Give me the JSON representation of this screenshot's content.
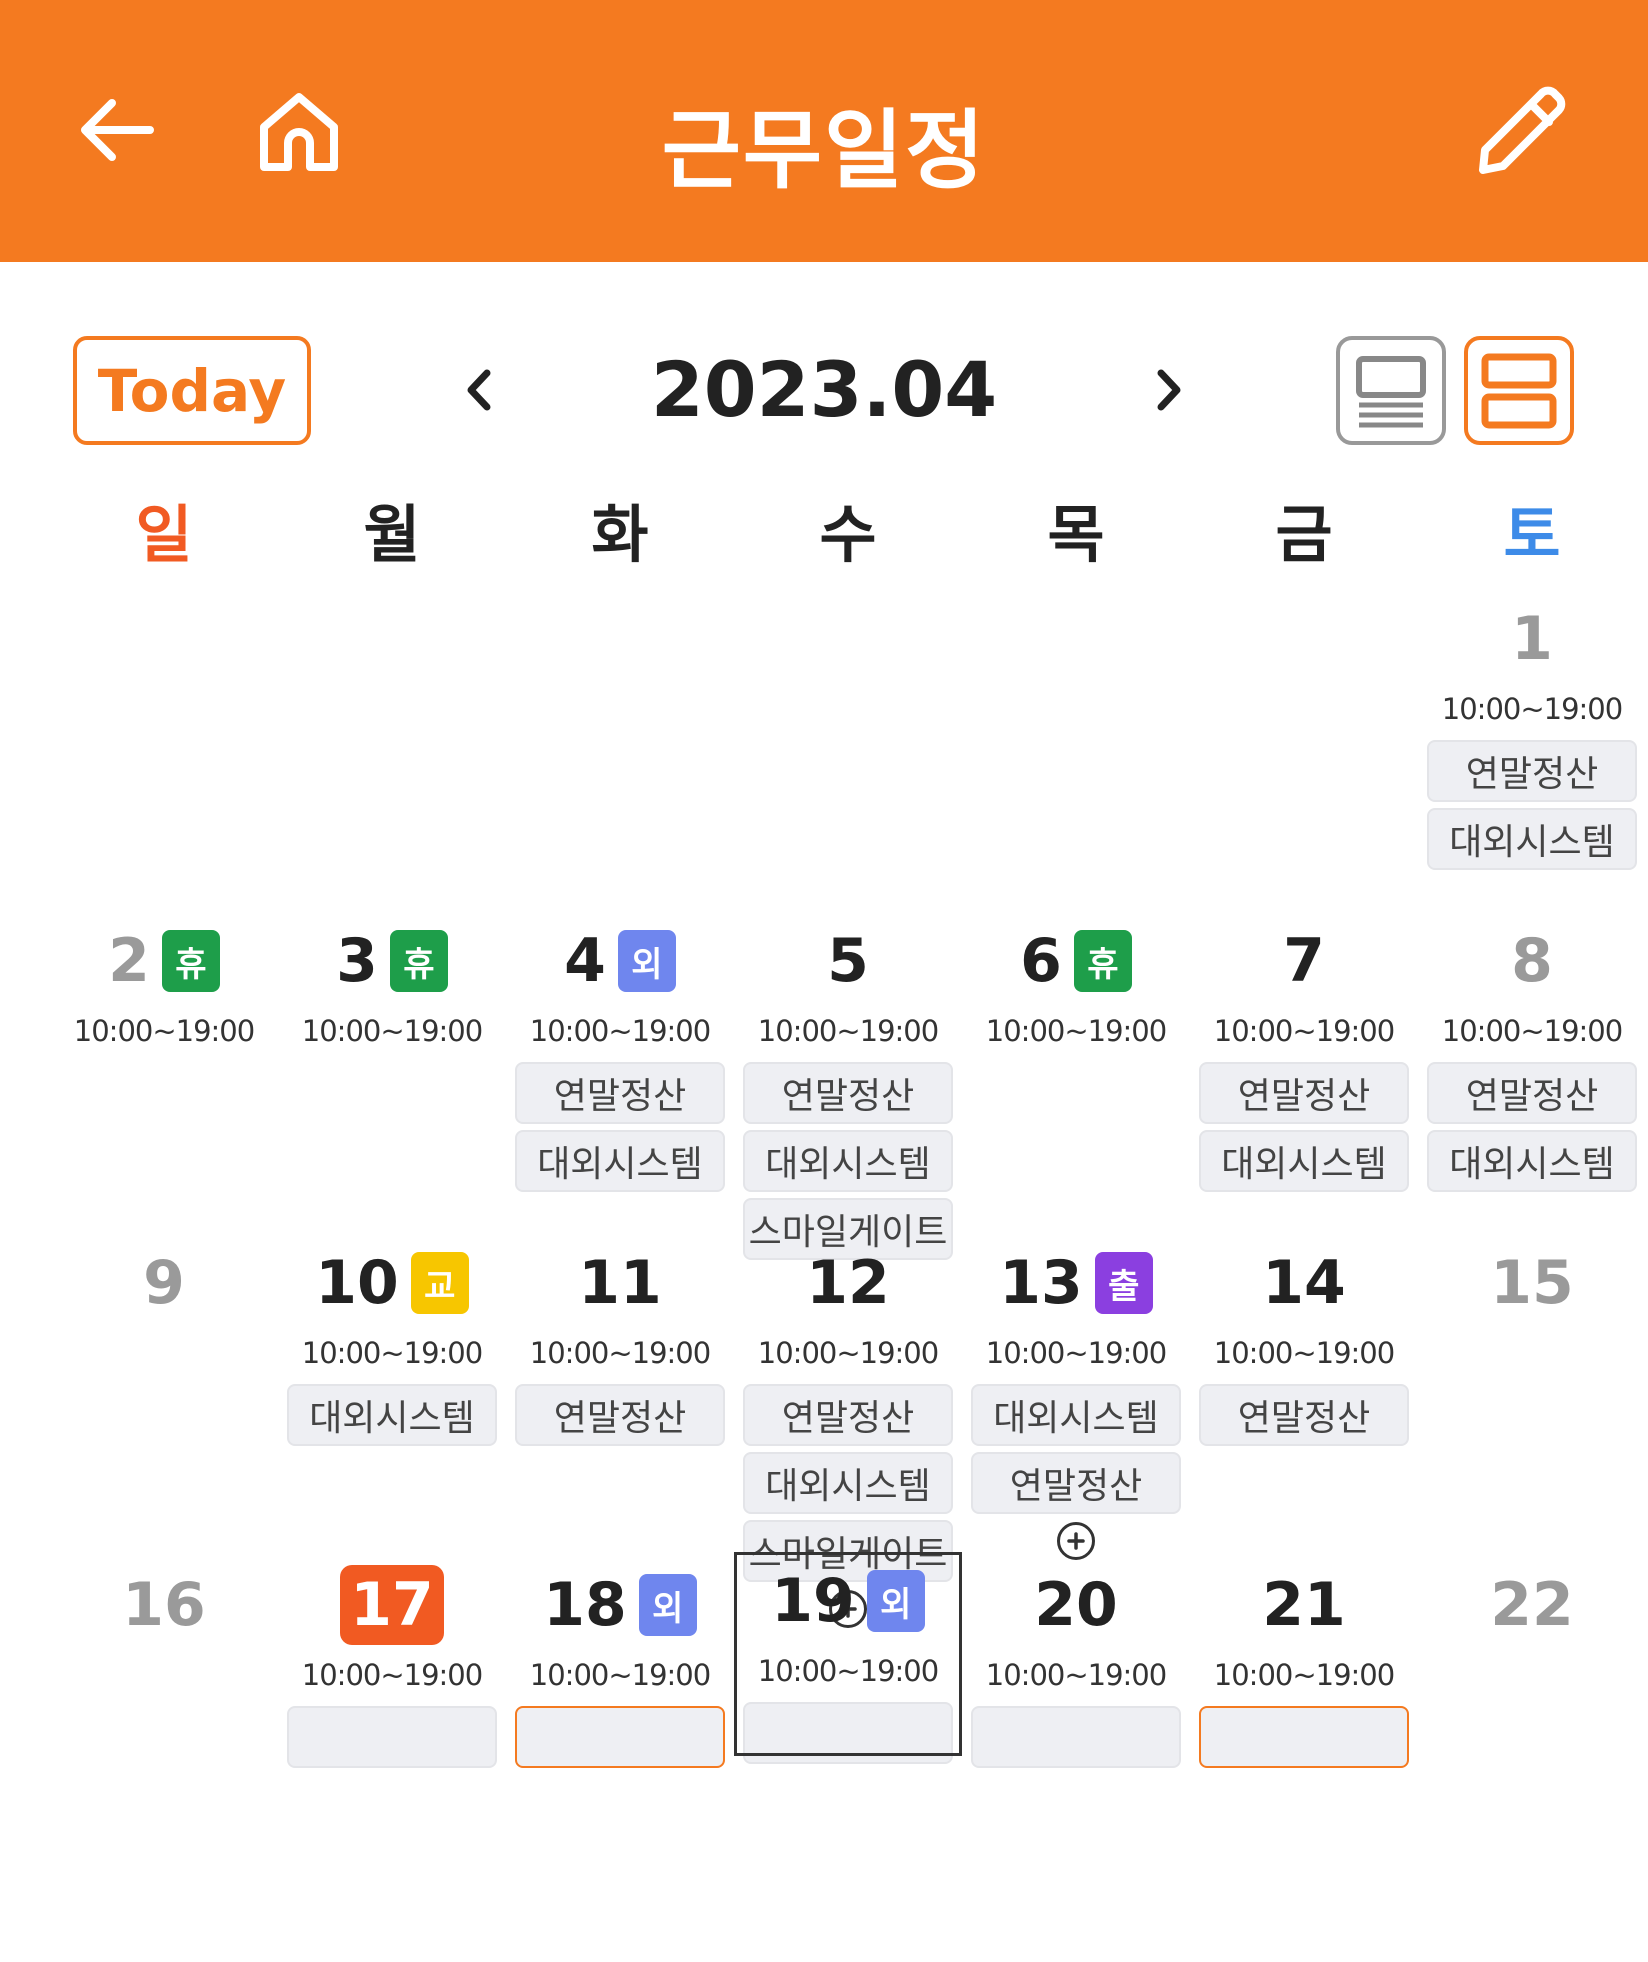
{
  "header": {
    "title": "근무일정",
    "back_icon": "arrow-left-icon",
    "home_icon": "home-icon",
    "edit_icon": "pencil-icon"
  },
  "toolbar": {
    "today_label": "Today",
    "month": "2023.04",
    "prev_icon": "chevron-left-icon",
    "next_icon": "chevron-right-icon",
    "view_list_icon": "list-view-icon",
    "view_split_icon": "split-view-icon"
  },
  "weekdays": [
    "일",
    "월",
    "화",
    "수",
    "목",
    "금",
    "토"
  ],
  "colors": {
    "accent": "#F47A20",
    "today": "#F15A22",
    "sunday": "#F15A22",
    "saturday": "#3D8BE8",
    "badge_rest": "#1E9E4A",
    "badge_out": "#6F86EE",
    "badge_edu": "#F7C600",
    "badge_trip": "#8B3FE0"
  },
  "weeks": [
    [
      null,
      null,
      null,
      null,
      null,
      null,
      {
        "day": "1",
        "weekend": true,
        "time": "10:00~19:00",
        "tags": [
          "연말정산",
          "대외시스템"
        ]
      }
    ],
    [
      {
        "day": "2",
        "weekend": true,
        "badge": "휴",
        "badge_color": "#1E9E4A",
        "time": "10:00~19:00",
        "tags": []
      },
      {
        "day": "3",
        "badge": "휴",
        "badge_color": "#1E9E4A",
        "time": "10:00~19:00",
        "tags": []
      },
      {
        "day": "4",
        "badge": "외",
        "badge_color": "#6F86EE",
        "time": "10:00~19:00",
        "tags": [
          "연말정산",
          "대외시스템"
        ]
      },
      {
        "day": "5",
        "time": "10:00~19:00",
        "tags": [
          "연말정산",
          "대외시스템",
          "스마일게이트"
        ]
      },
      {
        "day": "6",
        "badge": "휴",
        "badge_color": "#1E9E4A",
        "time": "10:00~19:00",
        "tags": []
      },
      {
        "day": "7",
        "time": "10:00~19:00",
        "tags": [
          "연말정산",
          "대외시스템"
        ]
      },
      {
        "day": "8",
        "weekend": true,
        "time": "10:00~19:00",
        "tags": [
          "연말정산",
          "대외시스템"
        ]
      }
    ],
    [
      {
        "day": "9",
        "weekend": true,
        "tags": []
      },
      {
        "day": "10",
        "badge": "교",
        "badge_color": "#F7C600",
        "time": "10:00~19:00",
        "tags": [
          "대외시스템"
        ]
      },
      {
        "day": "11",
        "time": "10:00~19:00",
        "tags": [
          "연말정산"
        ]
      },
      {
        "day": "12",
        "time": "10:00~19:00",
        "tags": [
          "연말정산",
          "대외시스템",
          "스마일게이트"
        ],
        "more": true
      },
      {
        "day": "13",
        "badge": "출",
        "badge_color": "#8B3FE0",
        "time": "10:00~19:00",
        "tags": [
          "대외시스템",
          "연말정산"
        ],
        "more": true
      },
      {
        "day": "14",
        "time": "10:00~19:00",
        "tags": [
          "연말정산"
        ]
      },
      {
        "day": "15",
        "weekend": true,
        "tags": []
      }
    ],
    [
      {
        "day": "16",
        "weekend": true,
        "tags": []
      },
      {
        "day": "17",
        "today": true,
        "time": "10:00~19:00",
        "tags": [],
        "partial_tag": true
      },
      {
        "day": "18",
        "badge": "외",
        "badge_color": "#6F86EE",
        "time": "10:00~19:00",
        "tags": [],
        "partial_tag": true,
        "partial_hl": true
      },
      {
        "day": "19",
        "badge": "외",
        "badge_color": "#6F86EE",
        "time": "10:00~19:00",
        "tags": [],
        "selected": true,
        "partial_tag": true
      },
      {
        "day": "20",
        "time": "10:00~19:00",
        "tags": [],
        "partial_tag": true
      },
      {
        "day": "21",
        "time": "10:00~19:00",
        "tags": [],
        "partial_tag": true,
        "partial_hl": true
      },
      {
        "day": "22",
        "weekend": true,
        "tags": []
      }
    ]
  ]
}
